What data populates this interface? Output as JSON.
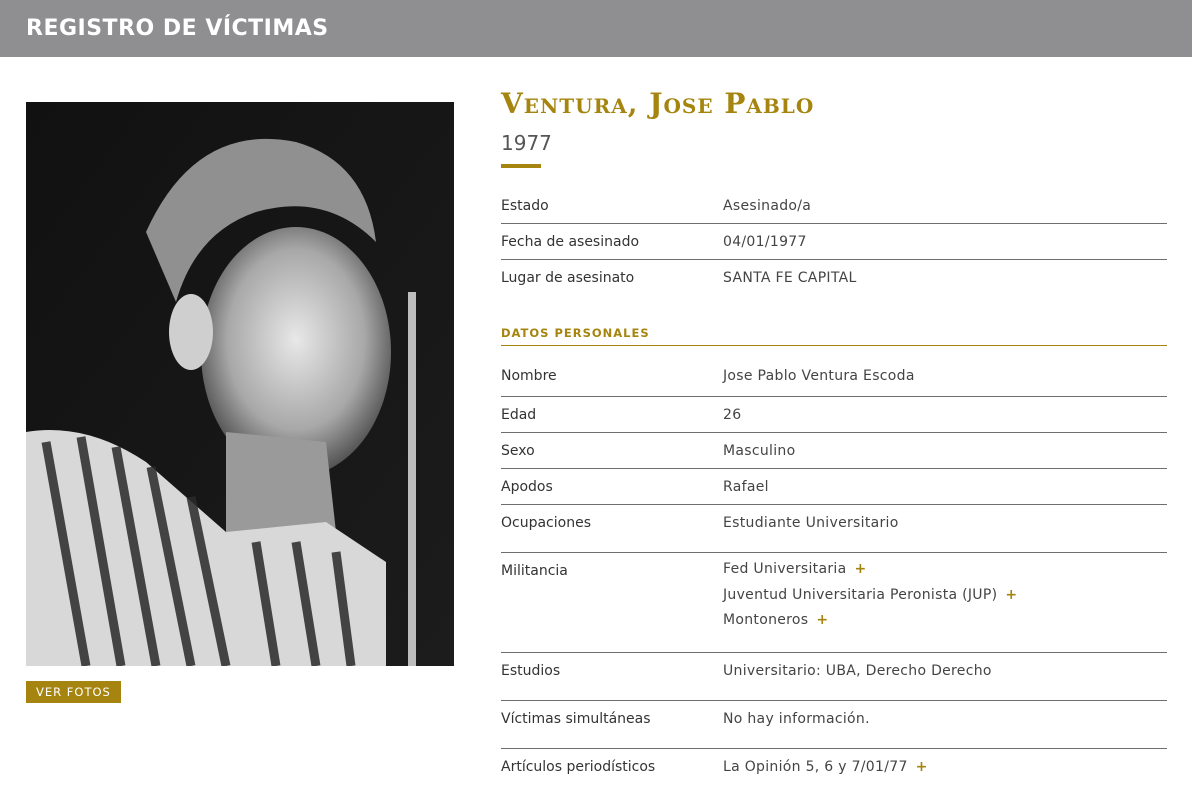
{
  "header": {
    "title": "REGISTRO DE VÍCTIMAS"
  },
  "photo": {
    "button_label": "VER FOTOS"
  },
  "person": {
    "name": "Ventura, Jose Pablo",
    "year": "1977"
  },
  "summary": [
    {
      "label": "Estado",
      "value": "Asesinado/a"
    },
    {
      "label": "Fecha de asesinado",
      "value": "04/01/1977"
    },
    {
      "label": "Lugar de asesinato",
      "value": "SANTA FE CAPITAL"
    }
  ],
  "personal": {
    "section_title": "DATOS PERSONALES",
    "rows": [
      {
        "label": "Nombre",
        "value": "Jose Pablo Ventura Escoda"
      },
      {
        "label": "Edad",
        "value": "26"
      },
      {
        "label": "Sexo",
        "value": "Masculino"
      },
      {
        "label": "Apodos",
        "value": "Rafael"
      },
      {
        "label": "Ocupaciones",
        "value": "Estudiante Universitario"
      }
    ],
    "militancia_label": "Militancia",
    "militancia": [
      "Fed Universitaria",
      "Juventud Universitaria Peronista (JUP)",
      "Montoneros"
    ],
    "estudios_label": "Estudios",
    "estudios_value": "Universitario: UBA, Derecho Derecho",
    "victimas_label": "Víctimas simultáneas",
    "victimas_value": "No hay información.",
    "articulos_label": "Artículos periodísticos",
    "articulos_value": "La Opinión 5, 6 y 7/01/77"
  },
  "icons": {
    "plus": "+"
  },
  "colors": {
    "accent": "#a5850f",
    "topbar": "#8f8f92"
  }
}
